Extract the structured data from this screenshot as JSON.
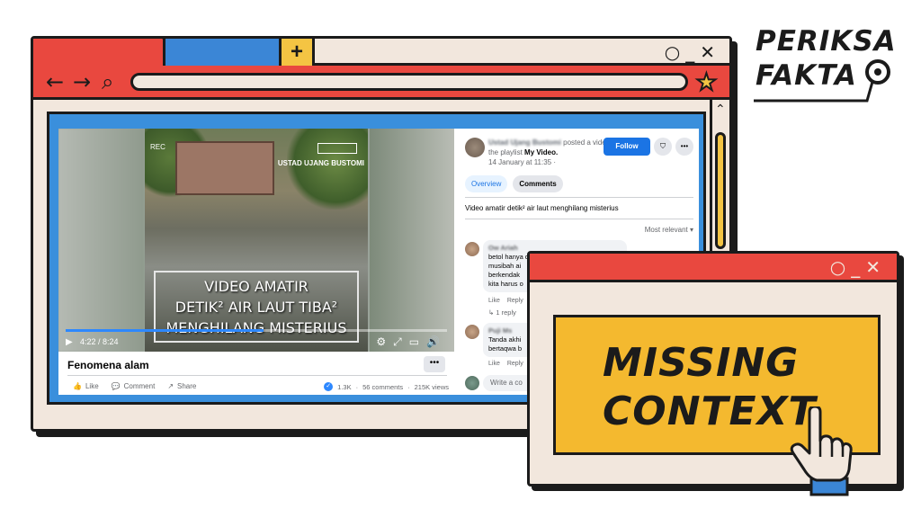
{
  "browser": {
    "new_tab": "+",
    "window_controls": "○_✕",
    "back_icon": "←",
    "forward_icon": "→",
    "search_icon": "⌕",
    "bookmark_icon": "★",
    "scroll_up_icon": "⌃"
  },
  "video": {
    "rec_label": "REC",
    "channel_watermark": "USTAD UJANG BUSTOMI",
    "caption_lines": [
      "VIDEO AMATIR",
      "DETIK² AIR LAUT TIBA²",
      "MENGHILANG MISTERIUS"
    ],
    "time": "4:22 / 8:24",
    "progress_fraction": 0.52,
    "title": "Fenomena alam",
    "more_label": "•••"
  },
  "actions": {
    "like": "Like",
    "comment": "Comment",
    "share": "Share"
  },
  "stats": {
    "reactions": "1.3K",
    "comments": "56 comments",
    "views": "215K views"
  },
  "post": {
    "author": "Ustad Ujang Bustomi",
    "posted_text": "posted a video to the playlist",
    "playlist": "My Video.",
    "date": "14 January at 11:35 ·",
    "follow_label": "Follow",
    "tab_overview": "Overview",
    "tab_comments": "Comments",
    "description": "Video amatir detik² air laut menghilang misterius",
    "sort": "Most relevant ▾"
  },
  "comments": [
    {
      "name": "Ow Ariah",
      "lines": [
        "betol hanya d",
        "musibah ai",
        "berkendak",
        "kita harus o"
      ],
      "like": "Like",
      "reply": "Reply"
    },
    {
      "name": "Puji Ms",
      "lines": [
        "Tanda akhi",
        "bertaqwa b"
      ],
      "like": "Like",
      "reply": "Reply"
    }
  ],
  "reply_count": "↳ 1 reply",
  "write_comment": "Write a co",
  "fact_check": {
    "window_controls": "○_✕",
    "label_line1": "MISSING",
    "label_line2": "CONTEXT"
  },
  "logo": {
    "line1": "PERIKSA",
    "line2": "FAKTA"
  }
}
